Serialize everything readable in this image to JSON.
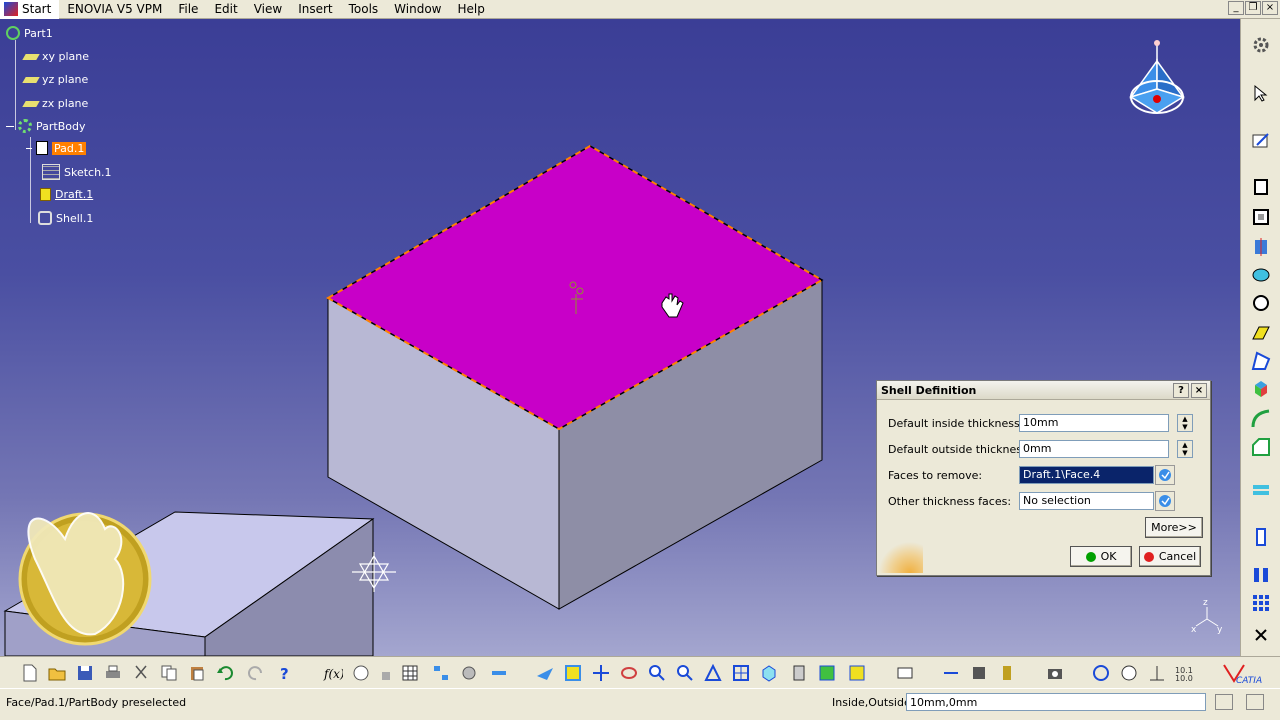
{
  "menu": {
    "start": "Start",
    "items": [
      "ENOVIA V5 VPM",
      "File",
      "Edit",
      "View",
      "Insert",
      "Tools",
      "Window",
      "Help"
    ]
  },
  "tree": {
    "root": "Part1",
    "xy": "xy plane",
    "yz": "yz plane",
    "zx": "zx plane",
    "body": "PartBody",
    "pad": "Pad.1",
    "sketch": "Sketch.1",
    "draft": "Draft.1",
    "shell": "Shell.1"
  },
  "dialog": {
    "title": "Shell Definition",
    "help_btn": "?",
    "close_btn": "×",
    "inside_label": "Default inside thickness:",
    "inside_value": "10mm",
    "outside_label": "Default outside thickness:",
    "outside_value": "0mm",
    "faces_label": "Faces to remove:",
    "faces_value": "Draft.1\\Face.4",
    "other_label": "Other thickness faces:",
    "other_value": "No selection",
    "more_btn": "More>>",
    "ok_btn": "OK",
    "cancel_btn": "Cancel"
  },
  "status": {
    "text": "Face/Pad.1/PartBody preselected",
    "prompt": "Inside,Outside",
    "input": "10mm,0mm"
  },
  "colors": {
    "face_highlight": "#c800c8",
    "edge_highlight": "#ff8000",
    "ok_dot": "#00a000",
    "cancel_dot": "#e02020",
    "selection_orange": "#ff8000"
  },
  "icons": {
    "compass": "compass-icon",
    "catia_logo": "catia-logo",
    "axis": "axis-triad-icon"
  }
}
